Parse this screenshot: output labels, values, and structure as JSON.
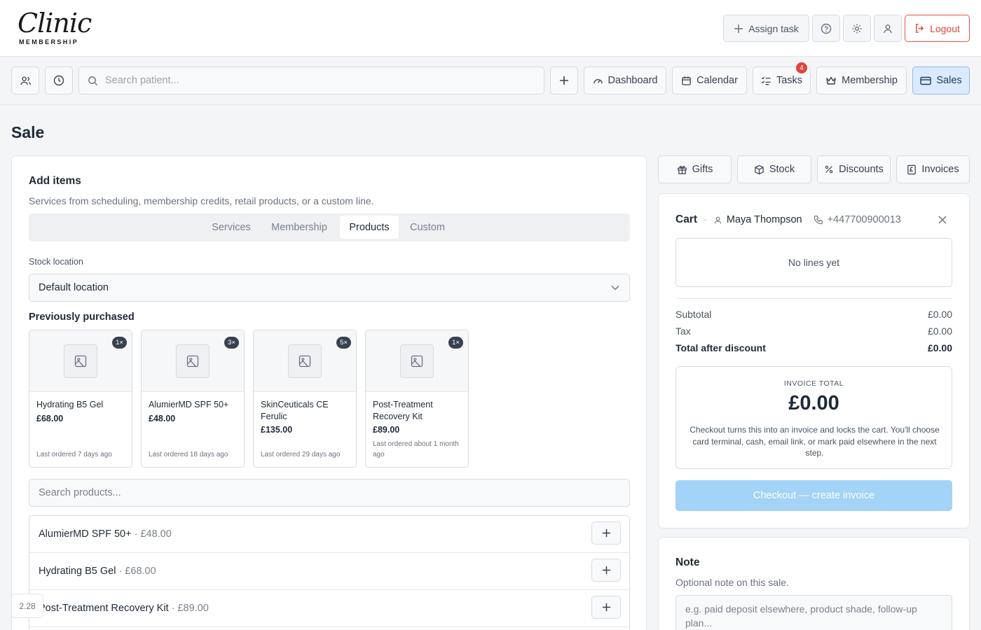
{
  "header": {
    "logo_script": "Clinic",
    "logo_sub": "MEMBERSHIP",
    "assign_task": "Assign task",
    "logout": "Logout",
    "icons": [
      "plus-icon",
      "help-icon",
      "gear-icon",
      "user-icon",
      "logout-icon"
    ]
  },
  "nav": {
    "search_placeholder": "Search patient...",
    "dashboard": "Dashboard",
    "calendar": "Calendar",
    "tasks": "Tasks",
    "tasks_badge": "4",
    "membership": "Membership",
    "sales": "Sales",
    "active": "Sales"
  },
  "page": {
    "title": "Sale"
  },
  "add_items": {
    "title": "Add items",
    "subtitle": "Services from scheduling, membership credits, retail products, or a custom line.",
    "tabs": [
      "Services",
      "Membership",
      "Products",
      "Custom"
    ],
    "active_tab": "Products",
    "stock_label": "Stock location",
    "stock_value": "Default location",
    "previously_title": "Previously purchased",
    "previous": [
      {
        "qty": "1×",
        "name": "Hydrating B5 Gel",
        "price": "£68.00",
        "last": "Last ordered 7 days ago"
      },
      {
        "qty": "3×",
        "name": "AlumierMD SPF 50+",
        "price": "£48.00",
        "last": "Last ordered 18 days ago"
      },
      {
        "qty": "5×",
        "name": "SkinCeuticals CE Ferulic",
        "price": "£135.00",
        "last": "Last ordered 29 days ago"
      },
      {
        "qty": "1×",
        "name": "Post-Treatment Recovery Kit",
        "price": "£89.00",
        "last": "Last ordered about 1 month ago"
      }
    ],
    "product_search_placeholder": "Search products...",
    "products": [
      {
        "name": "AlumierMD SPF 50+",
        "price": "· £48.00"
      },
      {
        "name": "Hydrating B5 Gel",
        "price": "· £68.00"
      },
      {
        "name": "Post-Treatment Recovery Kit",
        "price": "· £89.00"
      }
    ]
  },
  "right_tabs": [
    "Gifts",
    "Stock",
    "Discounts",
    "Invoices"
  ],
  "cart": {
    "title": "Cart",
    "dot": "·",
    "customer": "Maya Thompson",
    "phone": "+447700900013",
    "empty": "No lines yet",
    "subtotal_label": "Subtotal",
    "subtotal": "£0.00",
    "tax_label": "Tax",
    "tax": "£0.00",
    "total_label": "Total after discount",
    "total": "£0.00",
    "invoice_caption": "INVOICE TOTAL",
    "invoice_amount": "£0.00",
    "invoice_desc": "Checkout turns this into an invoice and locks the cart. You'll choose card terminal, cash, email link, or mark paid elsewhere in the next step.",
    "checkout": "Checkout — create invoice"
  },
  "note": {
    "title": "Note",
    "subtitle": "Optional note on this sale.",
    "placeholder": "e.g. paid deposit elsewhere, product shade, follow-up plan..."
  },
  "version": "2.28",
  "colors": {
    "accent": "#dbeafe",
    "danger": "#e0463c",
    "checkout": "#a3d3f7"
  }
}
